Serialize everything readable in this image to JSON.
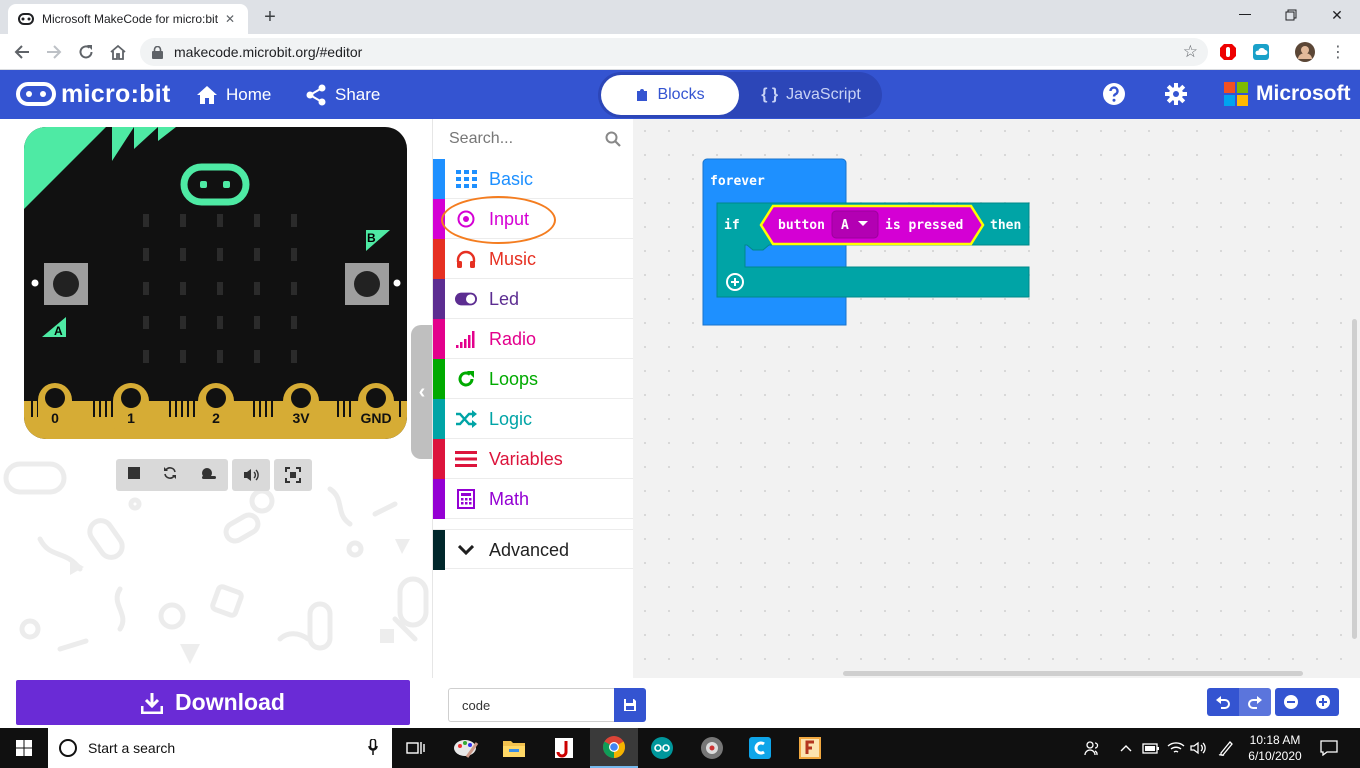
{
  "browser": {
    "tab_title": "Microsoft MakeCode for micro:bit",
    "url": "makecode.microbit.org/#editor"
  },
  "header": {
    "logo_text": "micro:bit",
    "home_label": "Home",
    "share_label": "Share",
    "blocks_label": "Blocks",
    "js_glyph": "{ }",
    "javascript_label": "JavaScript",
    "microsoft_label": "Microsoft"
  },
  "simulator": {
    "pin_labels": [
      "0",
      "1",
      "2",
      "3V",
      "GND"
    ],
    "button_a_label": "A",
    "button_b_label": "B"
  },
  "toolbox": {
    "search_placeholder": "Search...",
    "categories": [
      {
        "label": "Basic",
        "color": "#1e90ff",
        "icon": "grid-icon"
      },
      {
        "label": "Input",
        "color": "#d400d4",
        "icon": "target-icon"
      },
      {
        "label": "Music",
        "color": "#e63022",
        "icon": "headphones-icon"
      },
      {
        "label": "Led",
        "color": "#5c2d91",
        "icon": "toggle-icon"
      },
      {
        "label": "Radio",
        "color": "#e3008c",
        "icon": "signal-icon"
      },
      {
        "label": "Loops",
        "color": "#00aa00",
        "icon": "refresh-icon"
      },
      {
        "label": "Logic",
        "color": "#00a4a6",
        "icon": "shuffle-icon"
      },
      {
        "label": "Variables",
        "color": "#dc143c",
        "icon": "list-icon"
      },
      {
        "label": "Math",
        "color": "#9400d3",
        "icon": "calculator-icon"
      }
    ],
    "advanced_label": "Advanced",
    "advanced_color": "#00272b"
  },
  "workspace": {
    "forever_label": "forever",
    "if_label": "if",
    "button_label": "button",
    "button_value": "A",
    "is_pressed_label": "is pressed",
    "then_label": "then"
  },
  "bottom": {
    "download_label": "Download",
    "project_name": "code"
  },
  "taskbar": {
    "search_placeholder": "Start a search",
    "time": "10:18 AM",
    "date": "6/10/2020"
  },
  "colors": {
    "header_blue": "#3454d1",
    "download_purple": "#6a2bd6",
    "loops_block_blue": "#1e90ff",
    "logic_block_teal": "#00a4a6",
    "input_block_magenta": "#d400d4",
    "highlight_orange": "#f47d20",
    "sim_teal": "#4eeaa4",
    "sim_gold": "#d6ac35"
  }
}
